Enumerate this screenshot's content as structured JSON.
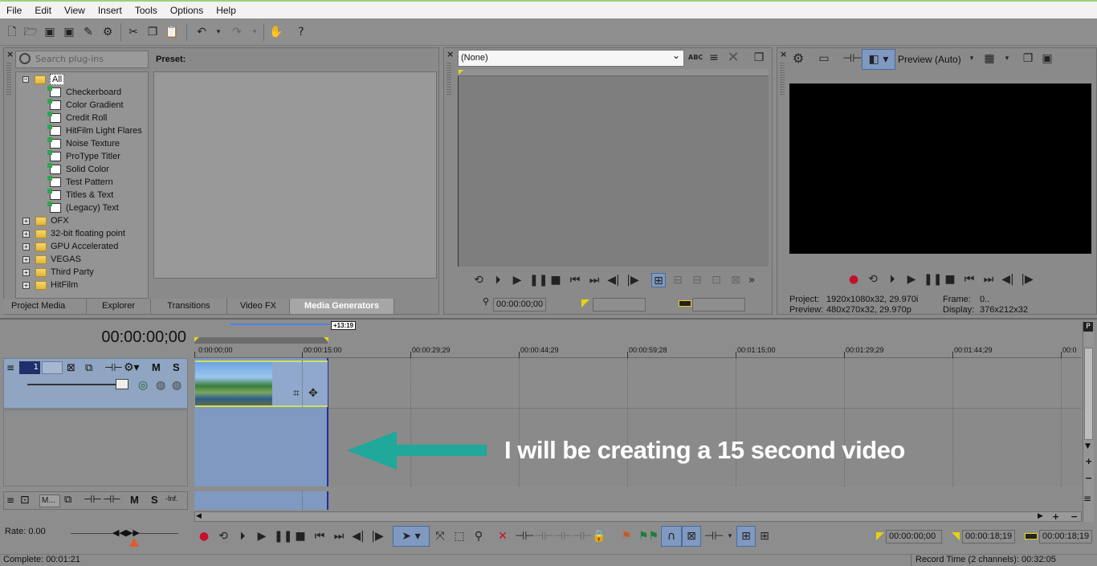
{
  "menu": [
    "File",
    "Edit",
    "View",
    "Insert",
    "Tools",
    "Options",
    "Help"
  ],
  "plugins": {
    "search_placeholder": "Search plug-ins",
    "preset_label": "Preset:",
    "tree": {
      "root": "All",
      "generators": [
        "Checkerboard",
        "Color Gradient",
        "Credit Roll",
        "HitFilm Light Flares",
        "Noise Texture",
        "ProType Titler",
        "Solid Color",
        "Test Pattern",
        "Titles & Text",
        "(Legacy) Text"
      ],
      "folders": [
        "OFX",
        "32-bit floating point",
        "GPU Accelerated",
        "VEGAS",
        "Third Party",
        "HitFilm"
      ]
    },
    "tabs": [
      "Project Media",
      "Explorer",
      "Transitions",
      "Video FX",
      "Media Generators"
    ],
    "active_tab": "Media Generators"
  },
  "trimmer": {
    "dropdown_value": "(None)",
    "tc_start": "00:00:00;00"
  },
  "preview": {
    "mode": "Preview (Auto)",
    "project_label": "Project:",
    "project_value": "1920x1080x32, 29.970i",
    "preview_label": "Preview:",
    "preview_value": "480x270x32, 29.970p",
    "frame_label": "Frame:",
    "frame_value": "0..",
    "display_label": "Display:",
    "display_value": "376x212x32"
  },
  "timeline": {
    "timecode": "00:00:00;00",
    "loop_length": "+13:19",
    "ruler": [
      "0:00:00;00",
      "00:00:15:00",
      "00:00:29;29",
      "00:00:44;29",
      "00:00:59;28",
      "00:01:15;00",
      "00:01:29;29",
      "00:01:44;29",
      "00:0"
    ],
    "track_number": "1",
    "mute_label": "M",
    "solo_label": "S",
    "audio_name": "M...",
    "audio_level": "-Inf.",
    "annotation": "I will be creating a 15 second video"
  },
  "bottom": {
    "rate": "Rate: 0.00",
    "sel_start": "00:00:00;00",
    "sel_end": "00:00:18;19",
    "sel_length": "00:00:18;19",
    "complete": "Complete: 00:01:21",
    "record_time": "Record Time (2 channels): 00:32:05"
  }
}
